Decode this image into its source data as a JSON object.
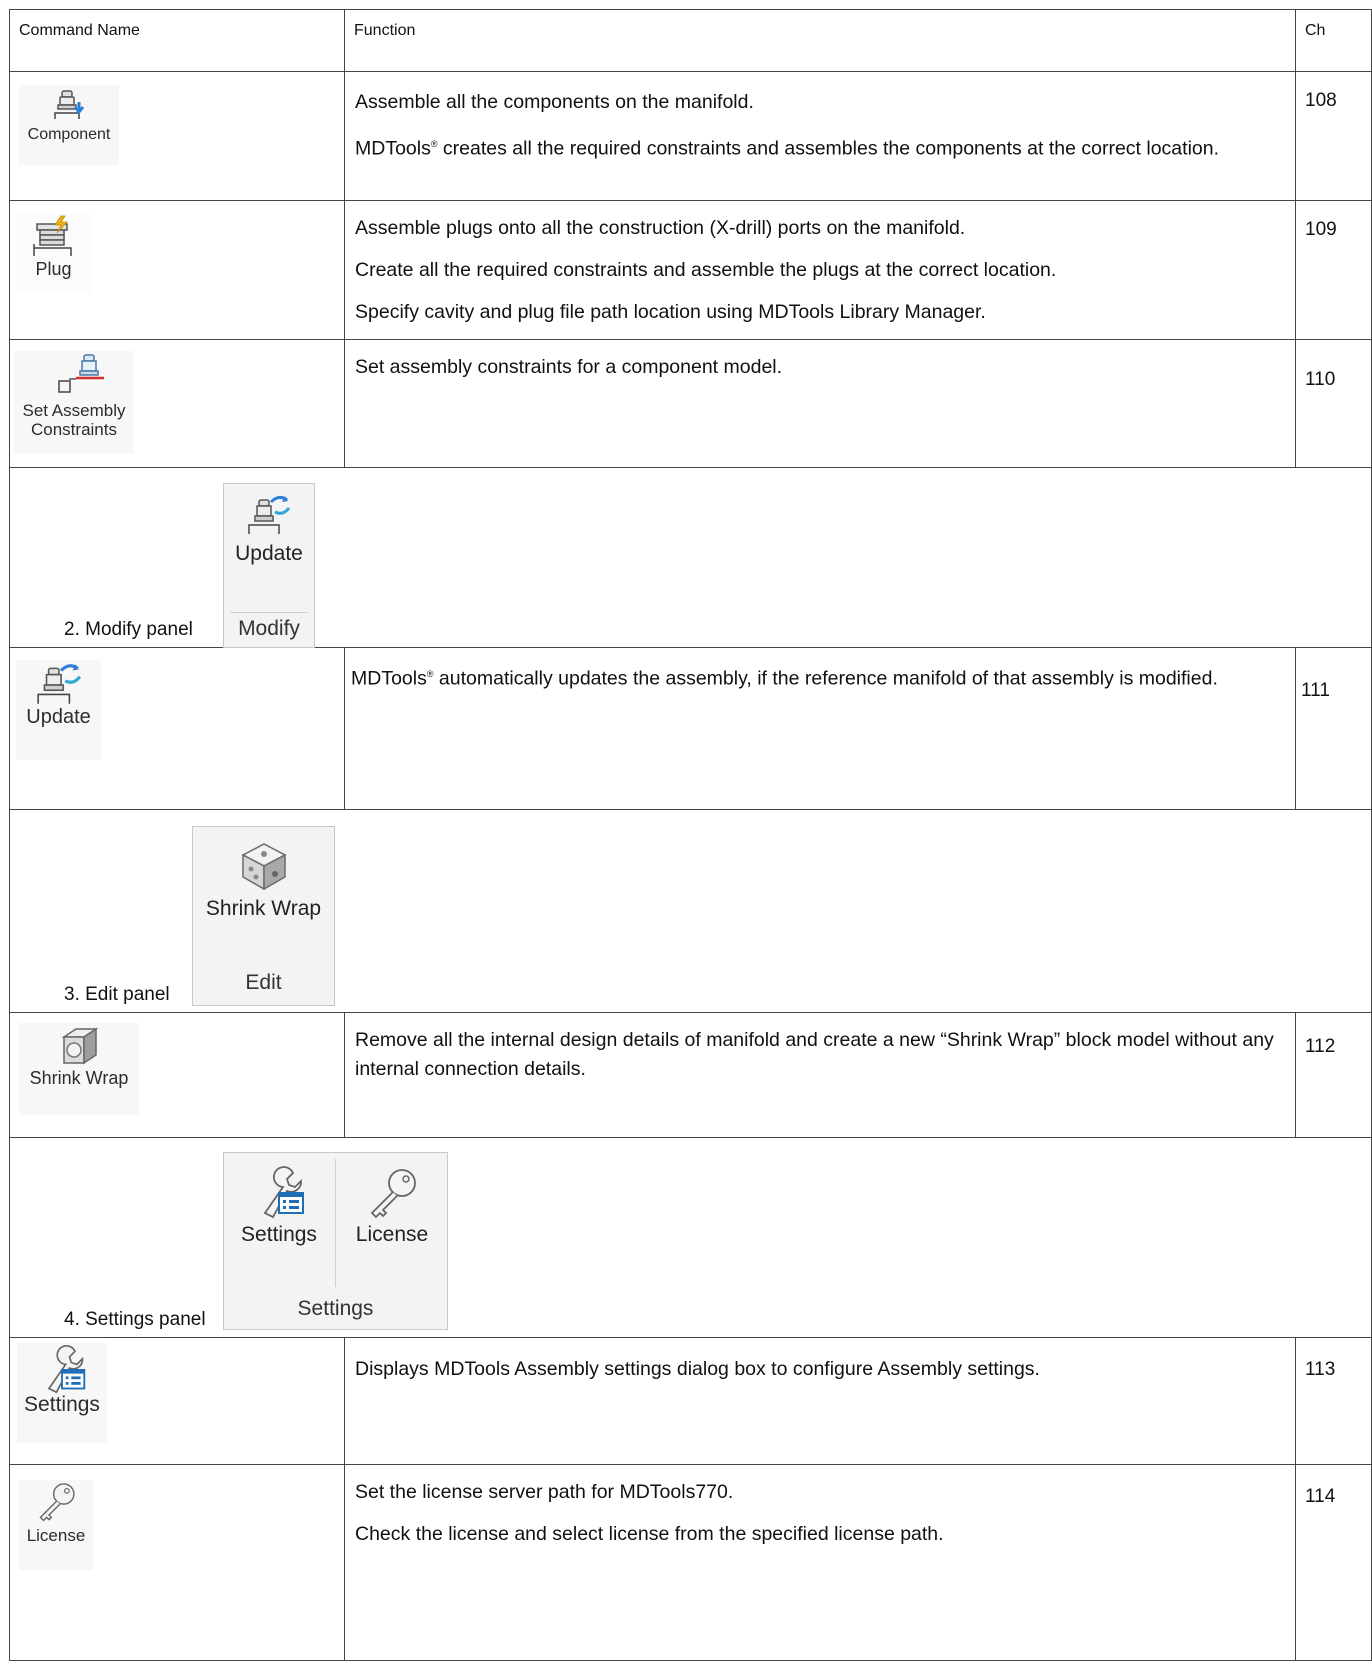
{
  "table": {
    "headers": {
      "command": "Command Name",
      "function": "Function",
      "ch": "Ch"
    },
    "rows": [
      {
        "label": "Component",
        "icon": "component-assemble-icon",
        "lines": [
          "Assemble all the components on the manifold."
        ],
        "line2_brand": "MDTools",
        "line2_sup": "®",
        "line2_rest": " creates all the required constraints and assembles the components at the correct location.",
        "ch": "108"
      },
      {
        "label": "Plug",
        "icon": "plug-icon",
        "lines": [
          "Assemble plugs onto all the construction (X-drill) ports on the manifold.",
          "Create all the required constraints and assemble the plugs at the correct location.",
          "Specify cavity and plug file path location using MDTools Library Manager."
        ],
        "ch": "109"
      },
      {
        "label_line1": "Set Assembly",
        "label_line2": "Constraints",
        "icon": "assembly-constraints-icon",
        "lines": [
          "Set assembly constraints for a component model."
        ],
        "ch": "110"
      },
      {
        "label": "Update",
        "icon": "update-icon",
        "brand": "MDTools",
        "sup": "®",
        "rest": " automatically updates the assembly, if the reference manifold of that assembly is modified.",
        "ch": "111"
      },
      {
        "label": "Shrink Wrap",
        "icon": "shrink-wrap-icon",
        "lines": [
          "Remove all the internal design details of manifold and create a new “Shrink Wrap” block model without any internal connection details."
        ],
        "ch": "112"
      },
      {
        "label": "Settings",
        "icon": "settings-icon",
        "lines": [
          "Displays MDTools Assembly settings dialog box to configure Assembly settings."
        ],
        "ch": "113"
      },
      {
        "label": "License",
        "icon": "license-key-icon",
        "lines": [
          "Set the license server path for MDTools770.",
          "Check the license and select license from the specified license path."
        ],
        "ch": "114"
      }
    ]
  },
  "panels": {
    "modify": {
      "label": "2. Modify panel",
      "button": "Update",
      "title": "Modify"
    },
    "edit": {
      "label": "3. Edit panel",
      "button": "Shrink Wrap",
      "title": "Edit"
    },
    "settings": {
      "label": "4. Settings panel",
      "button1": "Settings",
      "button2": "License",
      "title": "Settings"
    }
  }
}
